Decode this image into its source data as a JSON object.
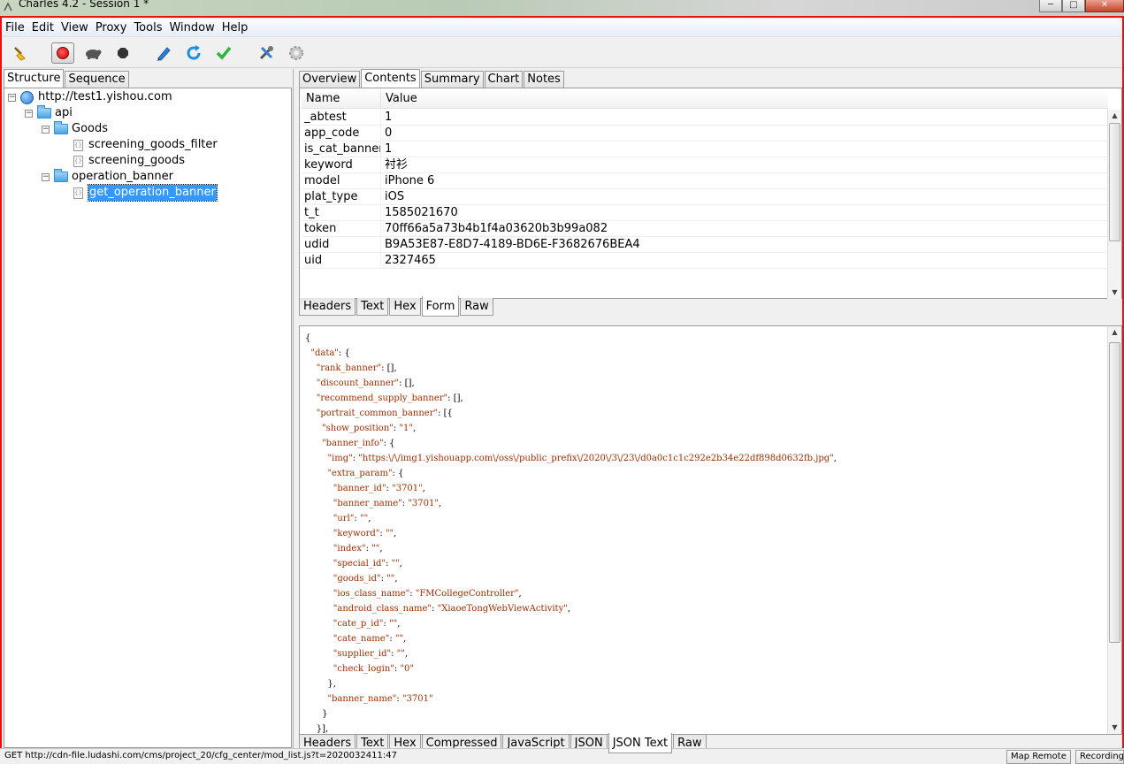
{
  "window": {
    "title": "Charles 4.2 - Session 1 *",
    "controls": [
      "─",
      "□",
      "✕"
    ]
  },
  "menu": [
    "File",
    "Edit",
    "View",
    "Proxy",
    "Tools",
    "Window",
    "Help"
  ],
  "toolbar": {
    "icons": [
      "broom-icon",
      "record-icon",
      "throttle-icon",
      "breakpoint-icon",
      "pen-icon",
      "refresh-icon",
      "check-icon",
      "tools-icon",
      "settings-icon"
    ]
  },
  "left_tabs": [
    "Structure",
    "Sequence"
  ],
  "tree": {
    "host": "http://test1.yishou.com",
    "folder_api": "api",
    "folder_goods": "Goods",
    "file_filter": "screening_goods_filter",
    "file_goods": "screening_goods",
    "folder_operation": "operation_banner",
    "file_selected": "get_operation_banner"
  },
  "right_tabs": [
    "Overview",
    "Contents",
    "Summary",
    "Chart",
    "Notes"
  ],
  "form_table": {
    "headers": [
      "Name",
      "Value"
    ],
    "rows": [
      {
        "name": "_abtest",
        "value": "1"
      },
      {
        "name": "app_code",
        "value": "0"
      },
      {
        "name": "is_cat_banner",
        "value": "1"
      },
      {
        "name": "keyword",
        "value": "衬衫"
      },
      {
        "name": "model",
        "value": "iPhone 6"
      },
      {
        "name": "plat_type",
        "value": "iOS"
      },
      {
        "name": "t_t",
        "value": "1585021670"
      },
      {
        "name": "token",
        "value": "70ff66a5a73b4b1f4a03620b3b99a082"
      },
      {
        "name": "udid",
        "value": "B9A53E87-E8D7-4189-BD6E-F3682676BEA4"
      },
      {
        "name": "uid",
        "value": "2327465"
      }
    ]
  },
  "request_tabs": [
    "Headers",
    "Text",
    "Hex",
    "Form",
    "Raw"
  ],
  "json_lines": [
    "{",
    "  \"data\": {",
    "    \"rank_banner\": [],",
    "    \"discount_banner\": [],",
    "    \"recommend_supply_banner\": [],",
    "    \"portrait_common_banner\": [{",
    "      \"show_position\": \"1\",",
    "      \"banner_info\": {",
    "        \"img\": \"https:\\/\\/img1.yishouapp.com\\/oss\\/public_prefix\\/2020\\/3\\/23\\/d0a0c1c1c292e2b34e22df898d0632fb.jpg\",",
    "        \"extra_param\": {",
    "          \"banner_id\": \"3701\",",
    "          \"banner_name\": \"3701\",",
    "          \"url\": \"\",",
    "          \"keyword\": \"\",",
    "          \"index\": \"\",",
    "          \"special_id\": \"\",",
    "          \"goods_id\": \"\",",
    "          \"ios_class_name\": \"FMCollegeController\",",
    "          \"android_class_name\": \"XiaoeTongWebViewActivity\",",
    "          \"cate_p_id\": \"\",",
    "          \"cate_name\": \"\",",
    "          \"supplier_id\": \"\",",
    "          \"check_login\": \"0\"",
    "        },",
    "        \"banner_name\": \"3701\"",
    "      }",
    "    }],"
  ],
  "response_tabs": [
    "Headers",
    "Text",
    "Hex",
    "Compressed",
    "JavaScript",
    "JSON",
    "JSON Text",
    "Raw"
  ],
  "status": {
    "text": "GET http://cdn-file.ludashi.com/cms/project_20/cfg_center/mod_list.js?t=2020032411:47",
    "map_remote": "Map Remote",
    "recording": "Recording"
  }
}
